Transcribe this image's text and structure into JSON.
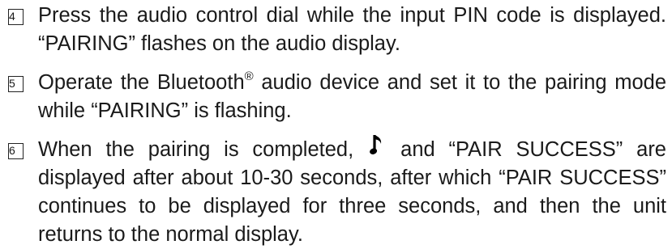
{
  "steps": [
    {
      "number": "4",
      "text": "Press the audio control dial while the input PIN code is displayed. “PAIRING” flashes on the audio display."
    },
    {
      "number": "5",
      "text_before": "Operate the Bluetooth",
      "superscript": "®",
      "text_after": " audio device and set it to the pairing mode while “PAIRING” is flashing."
    },
    {
      "number": "6",
      "text_before": "When the pairing is completed,",
      "icon": "music-note-icon",
      "text_after": "and “PAIR SUCCESS” are displayed after about 10-30 seconds, after which “PAIR SUCCESS” continues to be displayed for three seconds, and then the unit returns to the normal display."
    }
  ]
}
